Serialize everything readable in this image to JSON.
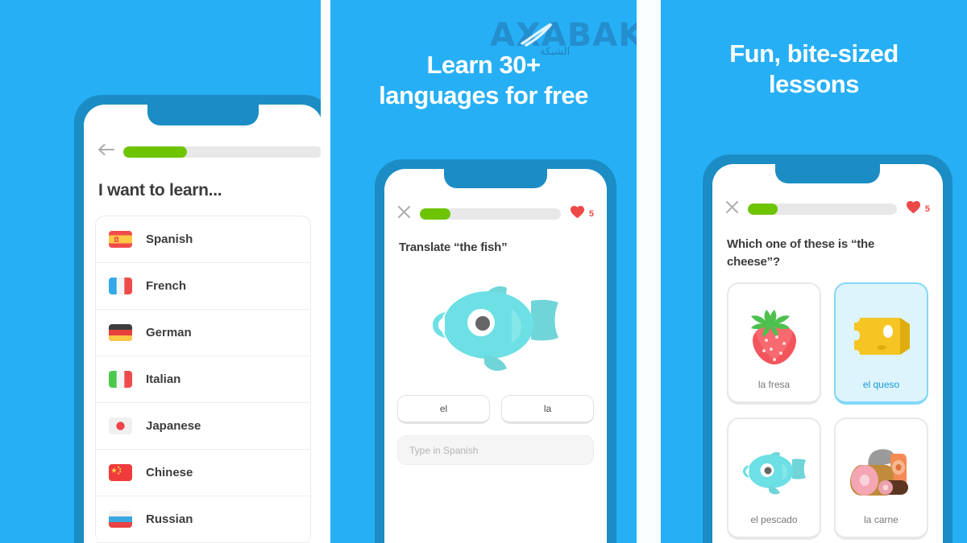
{
  "theme": {
    "background_blue": "#27aff5",
    "phone_frame_blue": "#1b8dc4",
    "progress_green": "#6ec400",
    "heart_red": "#ee4949",
    "selected_blue": "#1899d6",
    "selected_card_bg": "#ddf4fd",
    "text_dark": "#3c3c3c"
  },
  "watermark": {
    "text": "AXABAKA",
    "arabic": "الشبكة",
    "icon": "swoosh-icon"
  },
  "panel1": {
    "phone": {
      "topbar": {
        "back_icon": "back-arrow-icon",
        "progress_percent": 32
      },
      "title": "I want to learn...",
      "languages": [
        {
          "name": "Spanish",
          "flag": "flag-spain"
        },
        {
          "name": "French",
          "flag": "flag-france"
        },
        {
          "name": "German",
          "flag": "flag-germany"
        },
        {
          "name": "Italian",
          "flag": "flag-italy"
        },
        {
          "name": "Japanese",
          "flag": "flag-japan"
        },
        {
          "name": "Chinese",
          "flag": "flag-china"
        },
        {
          "name": "Russian",
          "flag": "flag-russia"
        }
      ]
    }
  },
  "panel2": {
    "headline": "Learn 30+\nlanguages for free",
    "phone": {
      "topbar": {
        "close_icon": "close-x-icon",
        "progress_percent": 22,
        "heart_icon": "heart-icon",
        "hearts": "5"
      },
      "prompt": "Translate “the fish”",
      "illustration": "fish-illustration",
      "word_bank": [
        "el",
        "la"
      ],
      "input_placeholder": "Type in Spanish",
      "input_value": ""
    }
  },
  "panel3": {
    "headline": "Fun, bite-sized\nlessons",
    "phone": {
      "topbar": {
        "close_icon": "close-x-icon",
        "progress_percent": 20,
        "heart_icon": "heart-icon",
        "hearts": "5"
      },
      "prompt": "Which one of these is “the cheese”?",
      "choices": [
        {
          "label": "la fresa",
          "art": "strawberry-illustration",
          "selected": false
        },
        {
          "label": "el queso",
          "art": "cheese-illustration",
          "selected": true
        },
        {
          "label": "el pescado",
          "art": "fish-illustration",
          "selected": false
        },
        {
          "label": "la carne",
          "art": "meat-illustration",
          "selected": false
        }
      ]
    }
  }
}
